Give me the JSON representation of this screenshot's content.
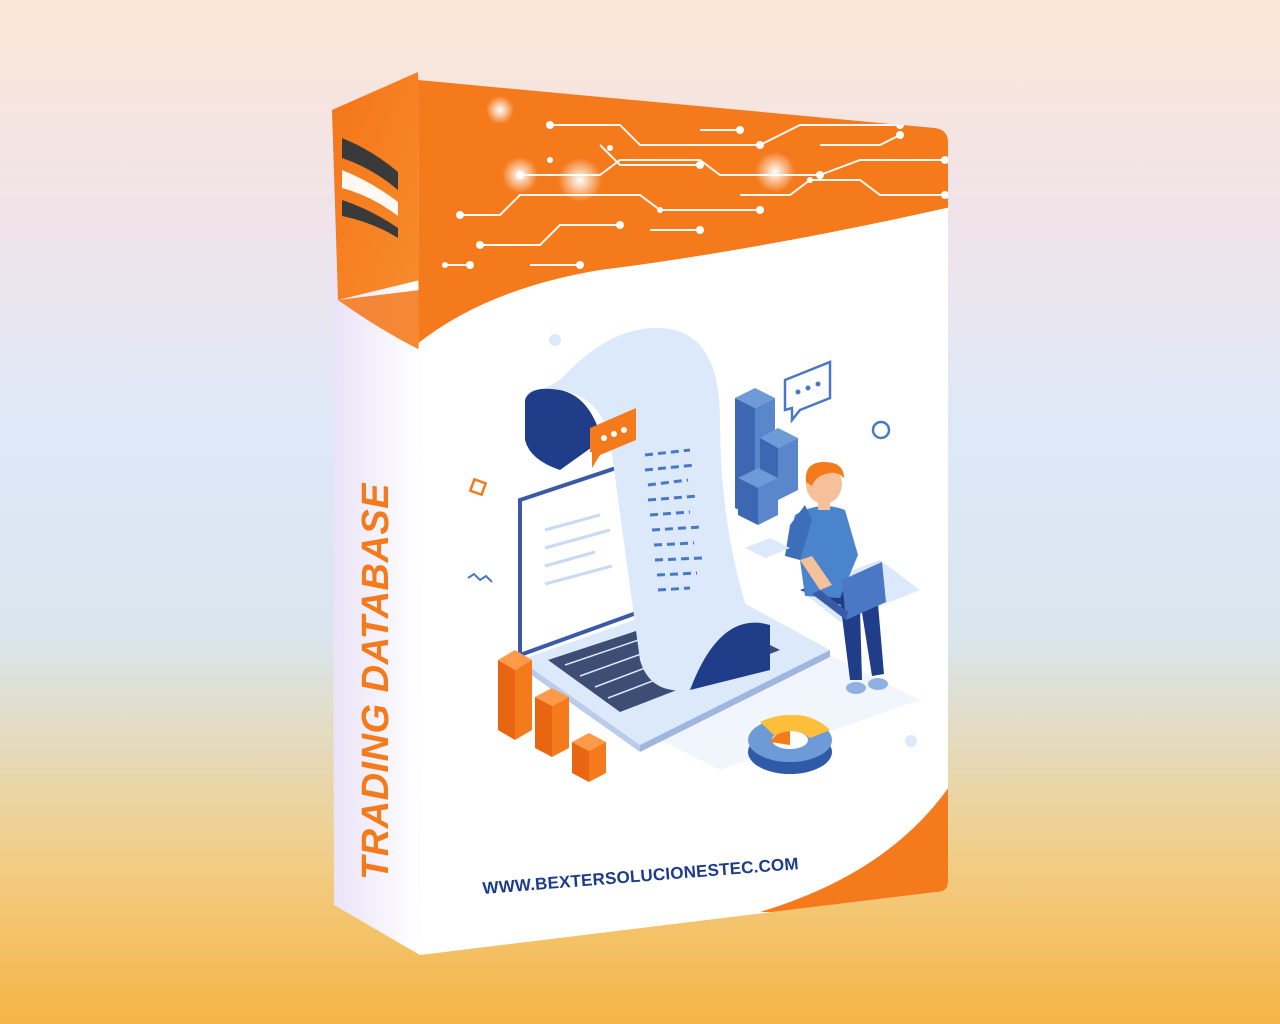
{
  "product": {
    "spine_title": "TRADING DATABASE",
    "website": "WWW.BEXTERSOLUCIONESTEC.COM"
  },
  "colors": {
    "brand_orange": "#f57a1c",
    "brand_navy": "#1c3b8a",
    "illustration_blue": "#4a78c4",
    "light_blue": "#dbe9fb"
  },
  "icons": [
    "brand-logo-icon",
    "circuit-pattern",
    "chat-bubble-icon",
    "person-with-laptop",
    "bar-chart-icon",
    "pie-chart-icon",
    "laptop-icon",
    "receipt-scroll"
  ]
}
